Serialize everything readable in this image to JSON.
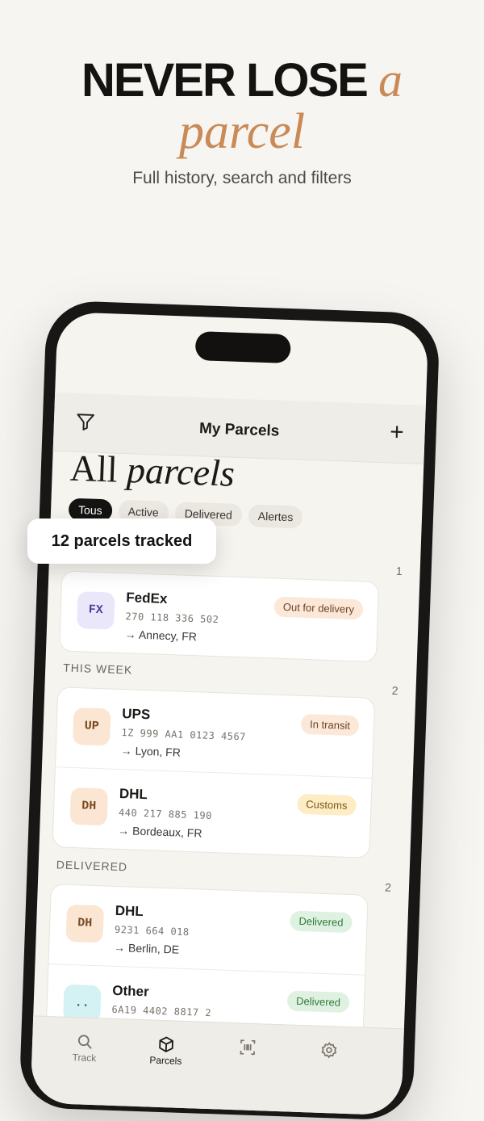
{
  "hero": {
    "title_main": "NEVER LOSE ",
    "title_accent": "a",
    "title_accent_line": "parcel",
    "subtitle": "Full history, search and filters"
  },
  "nav": {
    "title": "My Parcels",
    "add_label": "+"
  },
  "page": {
    "title_plain": "All ",
    "title_italic": "parcels"
  },
  "filters": [
    "Tous",
    "Active",
    "Delivered",
    "Alertes"
  ],
  "toast": "12 parcels tracked",
  "sections": [
    {
      "label": "",
      "count": "1",
      "parcels": [
        {
          "code": "FX",
          "carrier": "FedEx",
          "tracking": "270 118 336 502",
          "dest": "→ Annecy, FR",
          "status": "Out for delivery"
        }
      ]
    },
    {
      "label": "THIS WEEK",
      "count": "2",
      "parcels": [
        {
          "code": "UP",
          "carrier": "UPS",
          "tracking": "1Z 999 AA1 0123 4567",
          "dest": "→ Lyon, FR",
          "status": "In transit"
        },
        {
          "code": "DH",
          "carrier": "DHL",
          "tracking": "440 217 885 190",
          "dest": "→ Bordeaux, FR",
          "status": "Customs"
        }
      ]
    },
    {
      "label": "DELIVERED",
      "count": "2",
      "parcels": [
        {
          "code": "DH",
          "carrier": "DHL",
          "tracking": "9231 664 018",
          "dest": "→ Berlin, DE",
          "status": "Delivered"
        },
        {
          "code": "..",
          "carrier": "Other",
          "tracking": "6A19 4402 8817 2",
          "dest": "",
          "status": "Delivered"
        }
      ]
    }
  ],
  "tabs": [
    {
      "label": "Track",
      "icon": "search-icon"
    },
    {
      "label": "Parcels",
      "icon": "box-icon"
    },
    {
      "label": "",
      "icon": "barcode-scan-icon"
    },
    {
      "label": "",
      "icon": "gear-icon"
    }
  ],
  "colors": {
    "accent": "#c98a57",
    "background": "#f7f5f1",
    "fedex_avatar_bg": "#ebe7fb",
    "fedex_avatar_fg": "#4a3fa0",
    "ups_avatar_bg": "#fbe6d3",
    "ups_avatar_fg": "#7a4a1f",
    "dhl_avatar_bg": "#fbe6d3",
    "other_avatar_bg": "#d4f1f4",
    "out_for_delivery_bg": "#fbe8d8",
    "in_transit_bg": "#fbe8d8",
    "customs_bg": "#fdecc4",
    "delivered_bg": "#dff1e1",
    "delivered_fg": "#2f7a3c"
  }
}
